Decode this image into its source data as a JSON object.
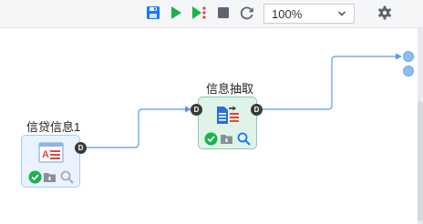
{
  "toolbar": {
    "zoom": {
      "value": "100%"
    },
    "icons": [
      "save-icon",
      "run-icon",
      "step-run-icon",
      "stop-icon",
      "refresh-icon",
      "chevron-down-icon",
      "gear-icon"
    ]
  },
  "colors": {
    "accent_blue": "#1677ff",
    "run_green": "#19b34c",
    "wire": "#5b9be8"
  },
  "nodes": [
    {
      "id": "credit",
      "label": "信贷信息1",
      "port": "D",
      "status": [
        "success-icon",
        "folder-icon",
        "search-icon"
      ]
    },
    {
      "id": "extract",
      "label": "信息抽取",
      "ports": [
        "D",
        "D"
      ],
      "status": [
        "success-icon",
        "folder-icon",
        "search-icon"
      ]
    }
  ]
}
